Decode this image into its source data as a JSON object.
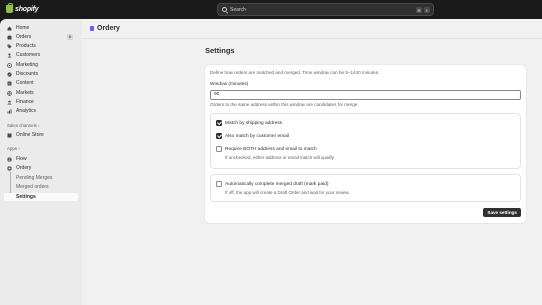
{
  "topbar": {
    "brand": "shopify",
    "search_placeholder": "Search",
    "shortcut_keys": [
      "⌘",
      "K"
    ]
  },
  "sidebar": {
    "items": [
      {
        "label": "Home",
        "icon": "home-icon"
      },
      {
        "label": "Orders",
        "icon": "orders-icon",
        "badge": "6"
      },
      {
        "label": "Products",
        "icon": "tag-icon"
      },
      {
        "label": "Customers",
        "icon": "person-icon"
      },
      {
        "label": "Marketing",
        "icon": "target-icon"
      },
      {
        "label": "Discounts",
        "icon": "discount-icon"
      },
      {
        "label": "Content",
        "icon": "content-icon"
      },
      {
        "label": "Markets",
        "icon": "globe-icon"
      },
      {
        "label": "Finance",
        "icon": "bank-icon"
      },
      {
        "label": "Analytics",
        "icon": "chart-icon"
      }
    ],
    "sales_channels_label": "Sales channels",
    "sales_channels": [
      {
        "label": "Online Store",
        "icon": "store-icon"
      }
    ],
    "apps_label": "Apps",
    "apps": [
      {
        "label": "Flow",
        "icon": "flow-icon"
      },
      {
        "label": "Ordery",
        "icon": "app-icon"
      }
    ],
    "app_subitems": [
      "Pending Merges",
      "Merged orders",
      "Settings"
    ],
    "active_subitem": "Settings"
  },
  "app_header": {
    "title": "Ordery",
    "icon_color": "#8051ff"
  },
  "page": {
    "title": "Settings",
    "description": "Define how orders are matched and merged. Time window can be 5–1440 minutes.",
    "window_label": "Window (minutes)",
    "window_value": "90",
    "window_help": "Orders to the same address within this window are candidates for merge.",
    "match_options": [
      {
        "label": "Match by shipping address",
        "checked": true
      },
      {
        "label": "Also match by customer email",
        "checked": true
      },
      {
        "label": "Require BOTH address and email to match",
        "checked": false,
        "help": "If unchecked, either address or email match will qualify."
      }
    ],
    "draft_option": {
      "label": "Automatically complete merged draft (mark paid)",
      "checked": false,
      "help": "If off, the app will create a Draft Order and wait for your review."
    },
    "save_label": "Save settings"
  }
}
